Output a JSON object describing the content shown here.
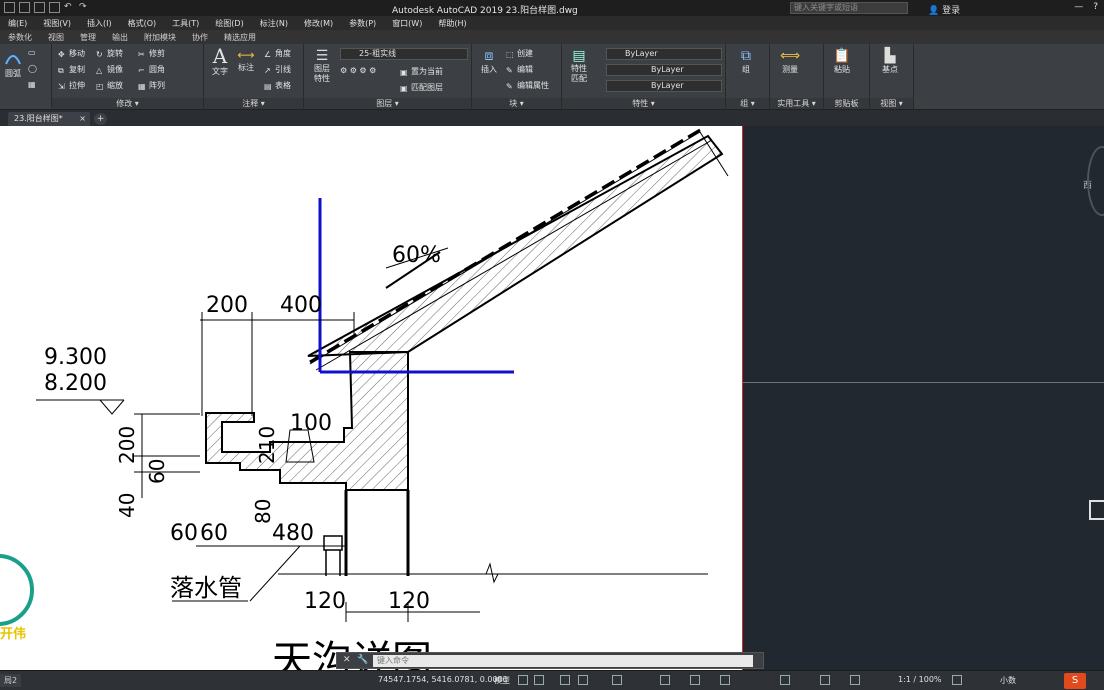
{
  "window": {
    "title": "Autodesk AutoCAD 2019    23.阳台样图.dwg",
    "search_placeholder": "键入关键字或短语",
    "login_label": "登录"
  },
  "menu": [
    "编(E)",
    "视图(V)",
    "插入(I)",
    "格式(O)",
    "工具(T)",
    "绘图(D)",
    "标注(N)",
    "修改(M)",
    "参数(P)",
    "窗口(W)",
    "帮助(H)"
  ],
  "ribbon_tabs": [
    "参数化",
    "视图",
    "管理",
    "输出",
    "附加模块",
    "协作",
    "精选应用"
  ],
  "ribbon": {
    "modify": {
      "title": "修改 ▾",
      "items": [
        "移动",
        "旋转",
        "修剪",
        "复制",
        "镜像",
        "圆角",
        "拉伸",
        "缩放",
        "阵列"
      ],
      "draw_left": "圆弧"
    },
    "annotation": {
      "title": "注释 ▾",
      "text": "文字",
      "dim": "标注",
      "items": [
        "角度",
        "引线",
        "表格"
      ]
    },
    "layers": {
      "title": "图层 ▾",
      "layer_props": "图层\n特性",
      "current_layer": "25-粗实线",
      "items": [
        "置为当前",
        "匹配图层"
      ]
    },
    "block": {
      "title": "块 ▾",
      "insert": "插入",
      "items": [
        "创建",
        "编辑",
        "编辑属性"
      ]
    },
    "properties": {
      "title": "特性 ▾",
      "match": "特性\n匹配",
      "combos": [
        "ByLayer",
        "ByLayer",
        "ByLayer"
      ]
    },
    "groups": {
      "title": "组 ▾",
      "label": "组"
    },
    "utilities": {
      "title": "实用工具 ▾",
      "label": "测量"
    },
    "clipboard": {
      "title": "剪贴板",
      "label": "粘贴"
    },
    "view": {
      "title": "视图 ▾",
      "label": "基点"
    }
  },
  "file_tab": "23.阳台样图*",
  "drawing": {
    "dims": {
      "d200": "200",
      "d400": "400",
      "slope": "60%",
      "elev1": "9.300",
      "elev2": "8.200",
      "d100": "100",
      "d210": "210",
      "d200v": "200",
      "d60v": "60",
      "d40": "40",
      "d80": "80",
      "d60a": "60",
      "d60b": "60",
      "d480": "480",
      "d120a": "120",
      "d120b": "120"
    },
    "label": "落水管",
    "watermark": "开伟",
    "bottom_title": "天沟详图"
  },
  "viewport": {
    "compass": "西"
  },
  "command": {
    "placeholder": "键入命令"
  },
  "status": {
    "coords": "74547.1754, 5416.0781, 0.0000",
    "model": "模型",
    "scale": "1:1 / 100%",
    "units": "小数",
    "layout": "局2"
  }
}
